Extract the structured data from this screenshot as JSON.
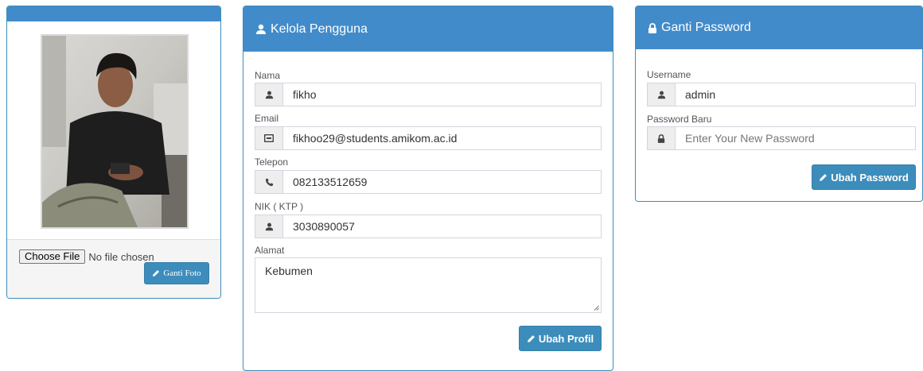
{
  "photo_panel": {
    "file_button": "Choose File",
    "file_status": "No file chosen",
    "ganti_foto": "Ganti Foto"
  },
  "profile": {
    "title": "Kelola Pengguna",
    "fields": {
      "nama": {
        "label": "Nama",
        "value": "fikho"
      },
      "email": {
        "label": "Email",
        "value": "fikhoo29@students.amikom.ac.id"
      },
      "telepon": {
        "label": "Telepon",
        "value": "082133512659"
      },
      "nik": {
        "label": "NIK ( KTP )",
        "value": "3030890057"
      },
      "alamat": {
        "label": "Alamat",
        "value": "Kebumen"
      }
    },
    "submit": "Ubah Profil"
  },
  "password": {
    "title": "Ganti Password",
    "username": {
      "label": "Username",
      "value": "admin"
    },
    "new_password": {
      "label": "Password Baru",
      "placeholder": "Enter Your New Password"
    },
    "submit": "Ubah Password"
  },
  "colors": {
    "header": "#428bca",
    "button": "#3c8dbc",
    "border": "#3c8dbc"
  },
  "icons": {
    "nama": "user-icon",
    "email": "envelope-icon",
    "telepon": "phone-icon",
    "nik": "user-icon",
    "username": "user-icon",
    "password": "lock-icon",
    "button": "pencil-icon"
  }
}
